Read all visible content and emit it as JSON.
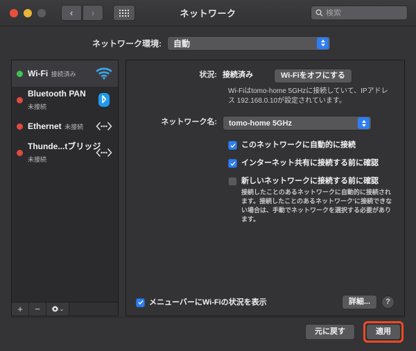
{
  "window": {
    "title": "ネットワーク",
    "traffic_lights": [
      "close",
      "minimize",
      "zoom"
    ],
    "nav_back": "‹",
    "nav_forward": "›",
    "show_all_icon": "grid-icon"
  },
  "search": {
    "placeholder": "検索",
    "value": "",
    "icon": "search-icon"
  },
  "location": {
    "label": "ネットワーク環境:",
    "value": "自動",
    "options": [
      "自動"
    ]
  },
  "sidebar": {
    "services": [
      {
        "name": "Wi-Fi",
        "state": "接続済み",
        "dot": "green",
        "icon": "wifi-icon",
        "selected": true
      },
      {
        "name": "Bluetooth PAN",
        "state": "未接続",
        "dot": "red",
        "icon": "bluetooth-icon",
        "selected": false
      },
      {
        "name": "Ethernet",
        "state": "未接続",
        "dot": "red",
        "icon": "ethernet-icon",
        "selected": false
      },
      {
        "name": "Thunde...tブリッジ",
        "state": "未接続",
        "dot": "red",
        "icon": "ethernet-icon",
        "selected": false
      }
    ],
    "toolbar": {
      "add_label": "+",
      "remove_label": "−",
      "gear_icon": "gear-icon",
      "gear_chevron": "⌄"
    }
  },
  "main": {
    "status_label": "状況:",
    "status_value": "接続済み",
    "wifi_toggle_label": "Wi-Fiをオフにする",
    "status_description": "Wi-Fiはtomo-home 5GHzに接続していて、IPアドレス 192.168.0.10が設定されています。",
    "network_name_label": "ネットワーク名:",
    "network_name_value": "tomo-home 5GHz",
    "network_name_options": [
      "tomo-home 5GHz"
    ],
    "checkboxes": [
      {
        "label": "このネットワークに自動的に接続",
        "checked": true
      },
      {
        "label": "インターネット共有に接続する前に確認",
        "checked": true
      },
      {
        "label": "新しいネットワークに接続する前に確認",
        "checked": false
      }
    ],
    "help_text": "接続したことのあるネットワークに自動的に接続されます。接続したことのあるネットワーク'に接続できない場合は、手動でネットワークを選択する必要があります。",
    "menubar_checkbox": {
      "label": "メニューバーにWi-Fiの状況を表示",
      "checked": true
    },
    "advanced_label": "詳細...",
    "help_button_label": "?"
  },
  "footer": {
    "revert_label": "元に戻す",
    "apply_label": "適用",
    "apply_highlight_color": "#f04a21"
  },
  "colors": {
    "accent": "#2f7ef0",
    "connected": "#41c452",
    "disconnected": "#e04a3f",
    "window_bg": "#343437",
    "sidebar_bg": "#2b2b2e",
    "panel_bg": "#333336"
  }
}
